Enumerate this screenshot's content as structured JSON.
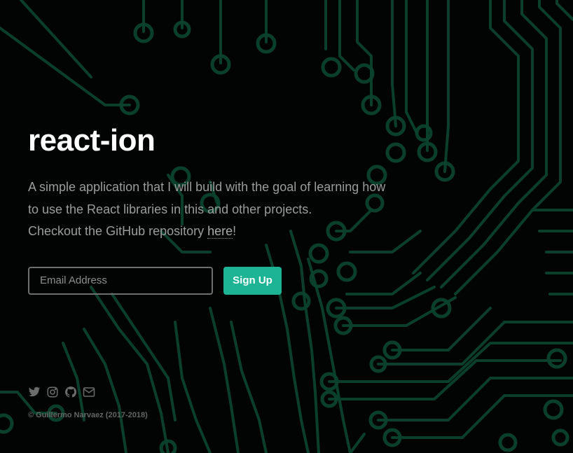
{
  "hero": {
    "title": "react-ion",
    "description_line1": "A simple application that I will build with the goal of learning how",
    "description_line2": "to use the React libraries in this and other projects.",
    "description_line3_prefix": "Checkout the GitHub repository ",
    "description_link": "here",
    "description_line3_suffix": "!"
  },
  "signup": {
    "email_placeholder": "Email Address",
    "button_label": "Sign Up"
  },
  "footer": {
    "icons": [
      "twitter-icon",
      "instagram-icon",
      "github-icon",
      "email-icon"
    ],
    "copyright": "© Guillermo Narvaez (2017-2018)"
  },
  "colors": {
    "background": "#030605",
    "circuit": "#0f5a3d",
    "accent": "#1cb495",
    "title": "#ffffff",
    "text": "#9a9d9c"
  }
}
